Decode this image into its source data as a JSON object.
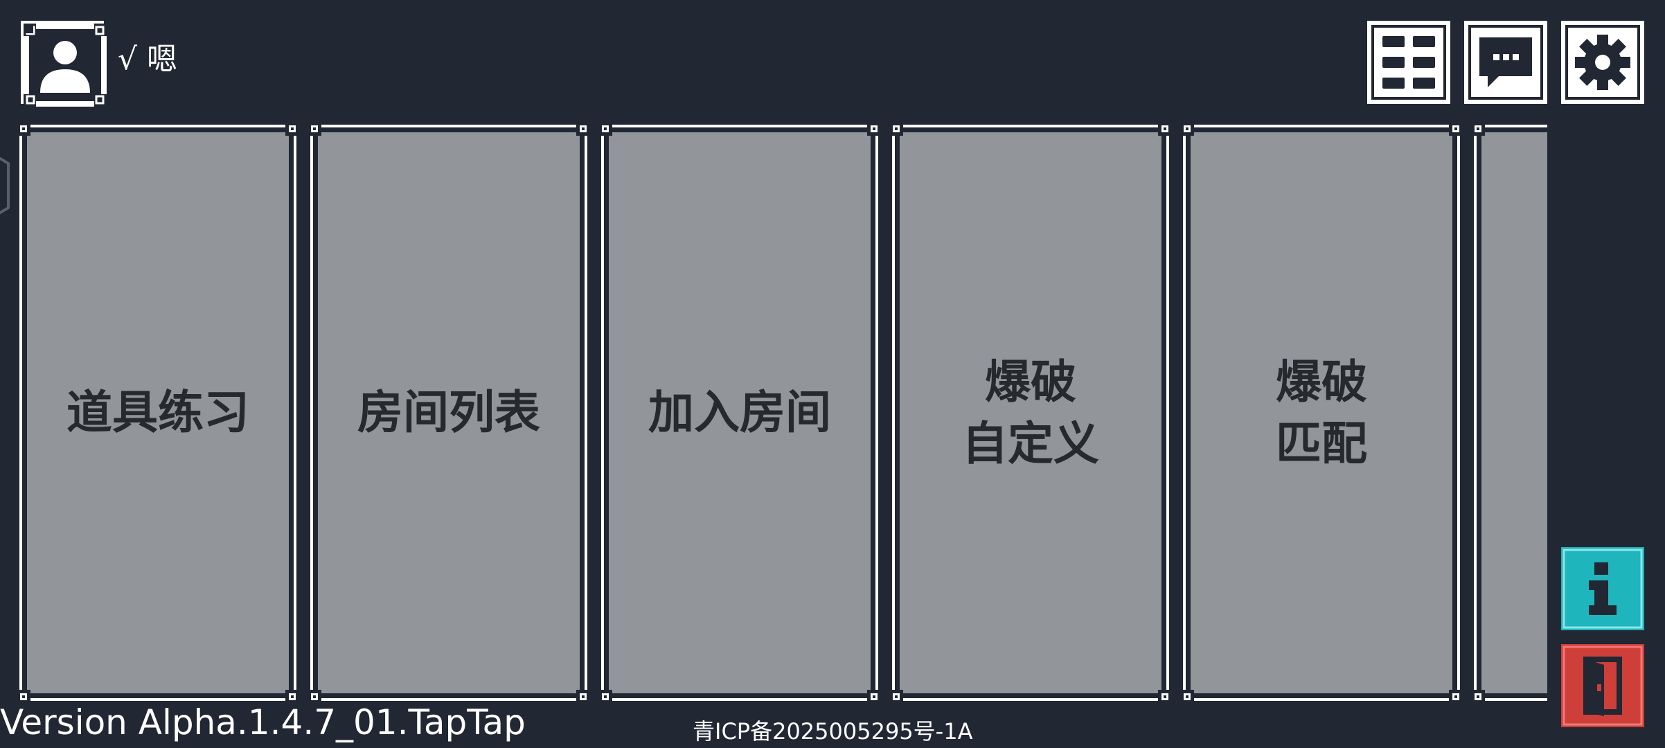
{
  "profile": {
    "username": "√ 嗯",
    "avatar_icon": "user-icon"
  },
  "toolbar": {
    "buttons": [
      {
        "id": "menu",
        "icon": "grid-icon"
      },
      {
        "id": "chat",
        "icon": "chat-icon"
      },
      {
        "id": "settings",
        "icon": "gear-icon"
      }
    ]
  },
  "cards": [
    {
      "lines": [
        "道具练习"
      ]
    },
    {
      "lines": [
        "房间列表"
      ]
    },
    {
      "lines": [
        "加入房间"
      ]
    },
    {
      "lines": [
        "爆破",
        "自定义"
      ]
    },
    {
      "lines": [
        "爆破",
        "匹配"
      ]
    },
    {
      "lines": []
    }
  ],
  "side_buttons": [
    {
      "id": "info",
      "icon": "info-icon",
      "color": "#1fb5bd"
    },
    {
      "id": "exit",
      "icon": "door-exit-icon",
      "color": "#cf3f3a"
    }
  ],
  "footer": {
    "version": "Version Alpha.1.4.7_01.TapTap",
    "icp": "青ICP备2025005295号-1A"
  },
  "colors": {
    "background": "#212733",
    "card_face": "#92959a",
    "card_text": "#26292e",
    "frame": "#ffffff"
  }
}
